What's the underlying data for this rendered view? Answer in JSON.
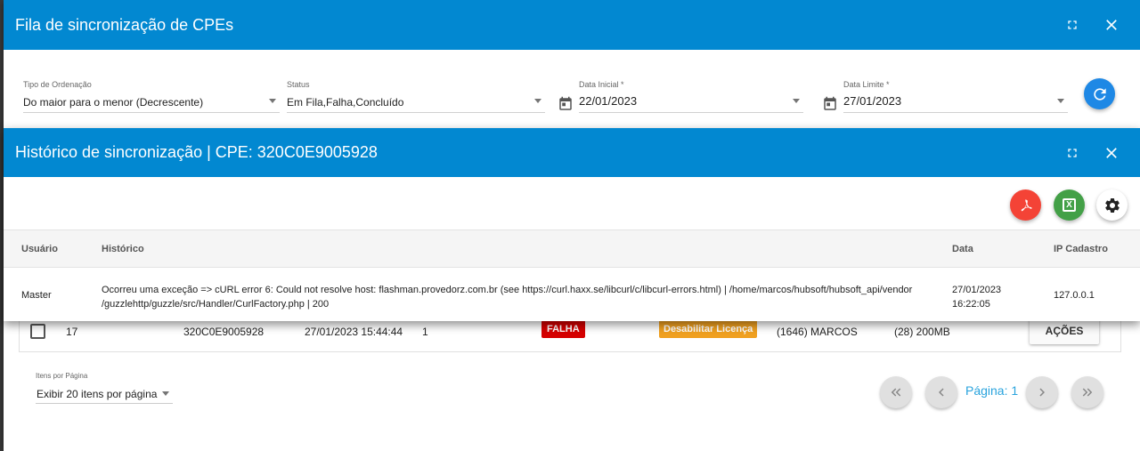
{
  "outer": {
    "title": "Fila de sincronização de CPEs",
    "filters": {
      "ordering": {
        "label": "Tipo de Ordenação",
        "value": "Do maior para o menor (Decrescente)"
      },
      "status": {
        "label": "Status",
        "value": "Em Fila,Falha,Concluído"
      },
      "start_date": {
        "label": "Data Inicial *",
        "value": "22/01/2023"
      },
      "end_date": {
        "label": "Data Limite *",
        "value": "27/01/2023"
      }
    },
    "row": {
      "id": "17",
      "cpe": "320C0E9005928",
      "datetime": "27/01/2023 15:44:44",
      "attempts": "1",
      "status": "FALHA",
      "action": "Desabilitar Licença",
      "user": "(1646) MARCOS",
      "plan": "(28) 200MB",
      "actions_label": "AÇÕES"
    },
    "pagination": {
      "per_page_label": "Itens por Página",
      "per_page_value": "Exibir 20 itens por página",
      "page_label": "Página: 1"
    }
  },
  "inner": {
    "title": "Histórico de sincronização | CPE: 320C0E9005928",
    "columns": {
      "user": "Usuário",
      "history": "Histórico",
      "date": "Data",
      "ip": "IP Cadastro"
    },
    "row": {
      "user": "Master",
      "history": "Ocorreu uma exceção => cURL error 6: Could not resolve host: flashman.provedorz.com.br (see https://curl.haxx.se/libcurl/c/libcurl-errors.html) | /home/marcos/hubsoft/hubsoft_api/vendor /guzzlehttp/guzzle/src/Handler/CurlFactory.php | 200",
      "date": "27/01/2023 16:22:05",
      "ip": "127.0.0.1"
    },
    "xls_letter": "X"
  },
  "colors": {
    "primary_bar": "#0288d1",
    "fail": "#d50000",
    "license": "#f0a020",
    "pdf": "#f44336",
    "excel": "#43a047"
  }
}
